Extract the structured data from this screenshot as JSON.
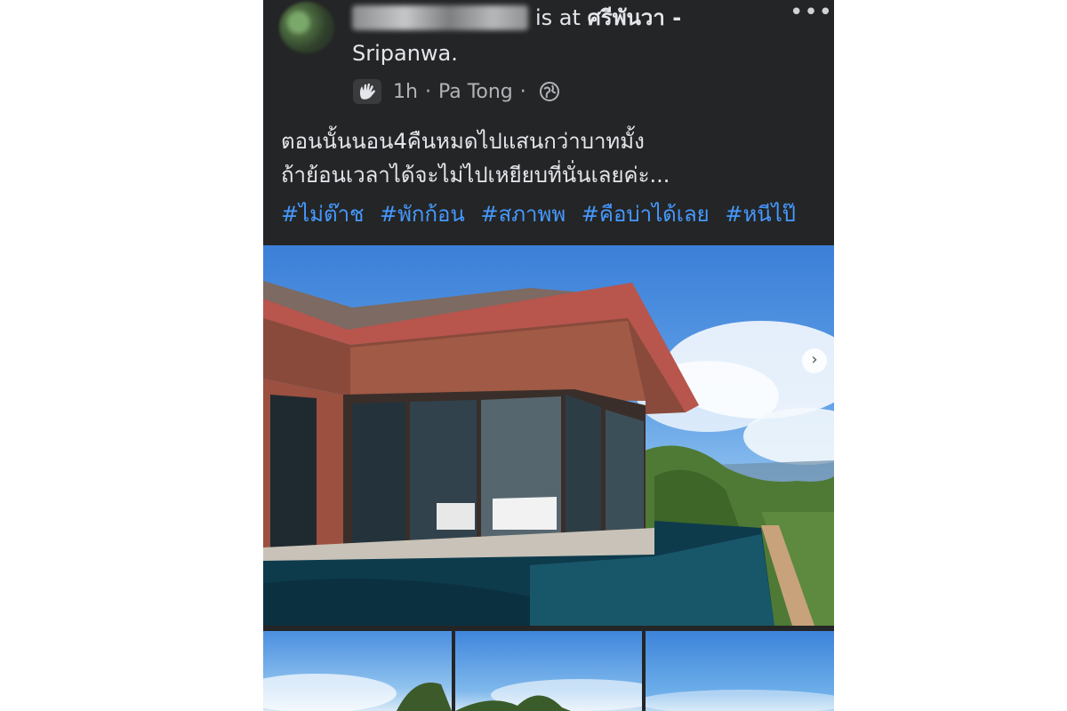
{
  "post": {
    "author_suffix": "is at",
    "place": "ศรีพันวา -",
    "place_line2": "Sripanwa.",
    "time": "1h",
    "location": "Pa Tong",
    "text": "ตอนนั้นนอน4คืนหมดไปแสนกว่าบาทมั้ง\nถ้าย้อนเวลาได้จะไม่ไปเหยียบที่นั่นเลยค่ะ...",
    "hashtags": [
      "#ไม่ต๊าช",
      "#พักก้อน",
      "#สภาพพ",
      "#คือบ่าได้เลย",
      "#หนีไป๊"
    ]
  },
  "icons": {
    "more": "more-options-icon",
    "activity": "waving-hand-icon",
    "privacy": "globe-icon",
    "next": "chevron-right-icon"
  },
  "colors": {
    "background": "#242526",
    "text": "#e4e6eb",
    "meta": "#b0b3b8",
    "hashtag": "#4599ff"
  }
}
